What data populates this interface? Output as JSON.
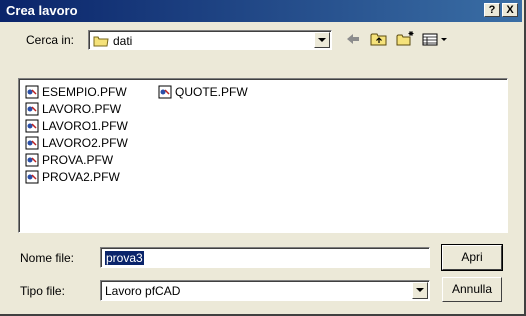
{
  "titlebar": {
    "title": "Crea lavoro",
    "help_label": "?",
    "close_label": "X"
  },
  "lookin": {
    "label": "Cerca in:",
    "value": "dati"
  },
  "files": [
    {
      "name": "ESEMPIO.PFW"
    },
    {
      "name": "LAVORO.PFW"
    },
    {
      "name": "LAVORO1.PFW"
    },
    {
      "name": "LAVORO2.PFW"
    },
    {
      "name": "PROVA.PFW"
    },
    {
      "name": "PROVA2.PFW"
    },
    {
      "name": "QUOTE.PFW"
    }
  ],
  "filename": {
    "label": "Nome file:",
    "value": "prova3"
  },
  "filetype": {
    "label": "Tipo file:",
    "value": "Lavoro pfCAD"
  },
  "buttons": {
    "open": "Apri",
    "cancel": "Annulla"
  },
  "colors": {
    "titlebar": "#0a246a",
    "dialog_bg": "#ece9d8",
    "selection": "#0a246a"
  },
  "icons": [
    "folder-icon",
    "back-arrow-icon",
    "up-folder-icon",
    "new-folder-icon",
    "view-menu-icon",
    "file-icon",
    "dropdown-arrow-icon"
  ]
}
